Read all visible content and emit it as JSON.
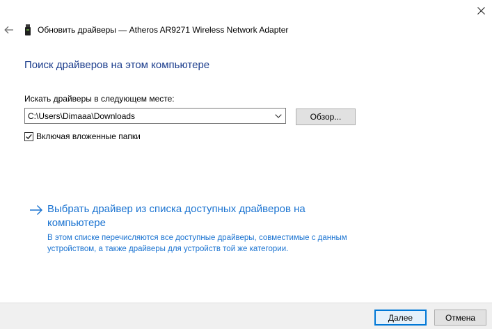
{
  "window": {
    "title": "Обновить драйверы — Atheros AR9271 Wireless Network Adapter",
    "close_icon": "close-icon",
    "back_icon": "back-arrow-icon",
    "device_icon": "network-adapter-icon"
  },
  "main": {
    "heading": "Поиск драйверов на этом компьютере",
    "search_label": "Искать драйверы в следующем месте:",
    "path_value": "C:\\Users\\Dimaaa\\Downloads",
    "browse_label": "Обзор...",
    "include_subfolders_label": "Включая вложенные папки",
    "include_subfolders_checked": true,
    "option": {
      "title": "Выбрать драйвер из списка доступных драйверов на компьютере",
      "description": "В этом списке перечисляются все доступные драйверы, совместимые с данным устройством, а также драйверы для устройств той же категории.",
      "icon": "arrow-right-icon",
      "color": "#1a73d1"
    }
  },
  "footer": {
    "next_label": "Далее",
    "cancel_label": "Отмена"
  },
  "colors": {
    "heading": "#1a3c8c",
    "accent": "#0078d7",
    "footer_bg": "#f0f0f0"
  }
}
